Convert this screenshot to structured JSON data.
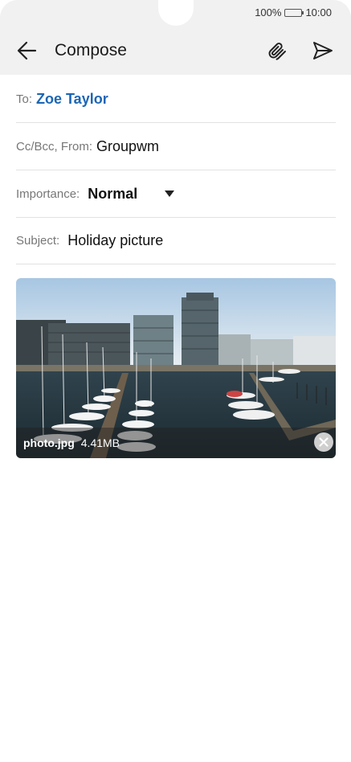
{
  "status": {
    "battery": "100%",
    "time": "10:00"
  },
  "toolbar": {
    "title": "Compose",
    "back_icon": "arrow-left-icon",
    "attach_icon": "paperclip-icon",
    "send_icon": "send-icon"
  },
  "fields": {
    "to": {
      "label": "To:",
      "value": "Zoe Taylor"
    },
    "from": {
      "label": "Cc/Bcc, From:",
      "value": "Groupwm"
    },
    "importance": {
      "label": "Importance:",
      "value": "Normal"
    },
    "subject": {
      "label": "Subject:",
      "value": "Holiday picture"
    }
  },
  "attachment": {
    "filename": "photo.jpg",
    "size": "4.41MB",
    "remove_icon": "close-icon"
  },
  "colors": {
    "recipient": "#1c66b5",
    "header_bg": "#f1f1f1"
  }
}
